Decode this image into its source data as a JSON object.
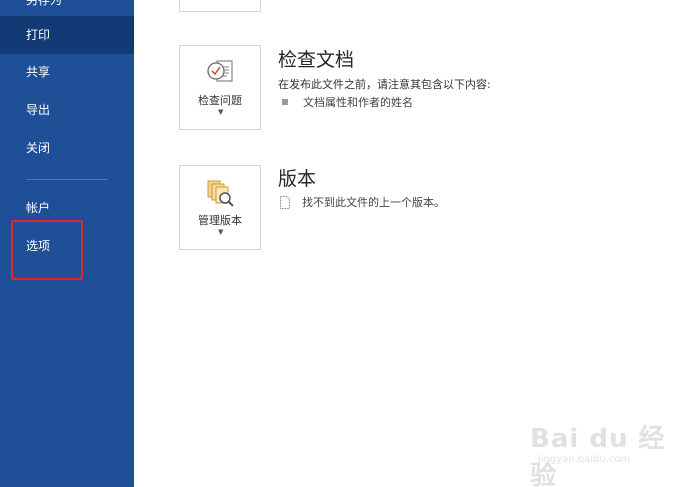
{
  "sidebar": {
    "items": [
      {
        "label": "另存为"
      },
      {
        "label": "打印"
      },
      {
        "label": "共享"
      },
      {
        "label": "导出"
      },
      {
        "label": "关闭"
      },
      {
        "label": "帐户"
      },
      {
        "label": "选项"
      }
    ],
    "selected": "打印",
    "background_color": "#1e4f97",
    "selected_color": "#133a75"
  },
  "inspect": {
    "button_label": "检查问题",
    "title": "检查文档",
    "description": "在发布此文件之前，请注意其包含以下内容:",
    "bullet": "文档属性和作者的姓名"
  },
  "versions": {
    "button_label": "管理版本",
    "title": "版本",
    "message": "找不到此文件的上一个版本。"
  },
  "watermark": {
    "main": "Bai du 经验",
    "sub": "jingyan.baidu.com"
  },
  "annotation": {
    "highlight_color": "#e0262b"
  }
}
